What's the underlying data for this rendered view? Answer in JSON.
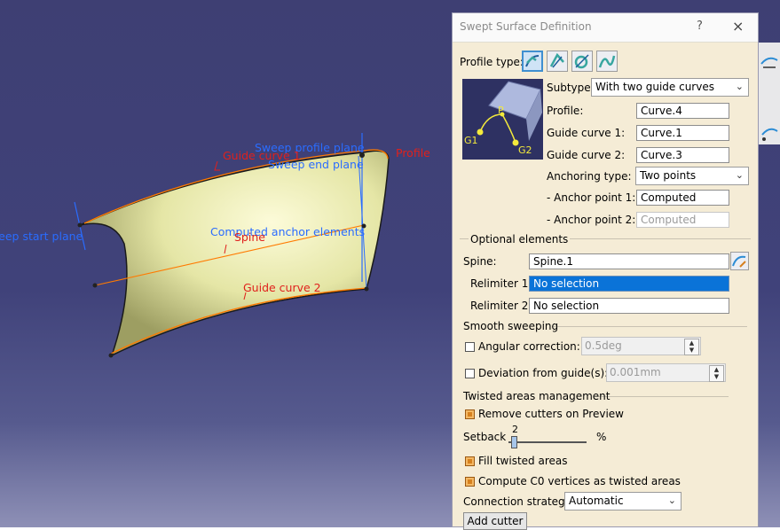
{
  "viewport": {
    "labels": {
      "sweep_profile_plane": "Sweep profile plane",
      "sweep_end_plane": "Sweep end plane",
      "guide_curve_1": "Guide curve 1",
      "profile": "Profile",
      "sweep_start_plane": "Sweep start plane",
      "computed_anchor": "Computed anchor elements",
      "spine": "Spine",
      "guide_curve_2": "Guide curve 2"
    }
  },
  "dialog": {
    "title": "Swept Surface Definition",
    "help": "?",
    "close": "×",
    "profile_type_label": "Profile type:",
    "preview_labels": {
      "p": "P",
      "g1": "G1",
      "g2": "G2"
    },
    "subtype_label": "Subtype:",
    "subtype_value": "With two guide curves",
    "profile_label": "Profile:",
    "profile_value": "Curve.4",
    "guide1_label": "Guide curve 1:",
    "guide1_value": "Curve.1",
    "guide2_label": "Guide curve 2:",
    "guide2_value": "Curve.3",
    "anchoring_label": "Anchoring type:",
    "anchoring_value": "Two points",
    "anchor1_label": "- Anchor point 1:",
    "anchor1_value": "Computed",
    "anchor2_label": "- Anchor point 2:",
    "anchor2_value": "Computed",
    "optional_title": "Optional elements",
    "spine_label": "Spine:",
    "spine_value": "Spine.1",
    "relimiter1_label": "Relimiter 1:",
    "relimiter1_value": "No selection",
    "relimiter2_label": "Relimiter 2:",
    "relimiter2_value": "No selection",
    "smooth_title": "Smooth sweeping",
    "angular_label": "Angular correction:",
    "angular_value": "0.5deg",
    "deviation_label": "Deviation from guide(s):",
    "deviation_value": "0.001mm",
    "twisted_title": "Twisted areas management",
    "remove_cutters_label": "Remove cutters on Preview",
    "setback_label": "Setback",
    "setback_value": "2",
    "setback_unit": "%",
    "fill_twisted_label": "Fill twisted areas",
    "compute_c0_label": "Compute C0 vertices as twisted areas",
    "connection_label": "Connection strategy:",
    "connection_value": "Automatic",
    "add_cutter_label": "Add cutter"
  },
  "colors": {
    "annotation_red": "#e0201c",
    "annotation_blue": "#2a6cff",
    "selection_blue": "#0a73d8",
    "dialog_bg": "#f5ecd6"
  },
  "icons": [
    "help-icon",
    "close-icon",
    "profile-type-explicit-icon",
    "profile-type-line-icon",
    "profile-type-circle-icon",
    "profile-type-conic-icon",
    "spine-select-icon",
    "chevron-down-icon"
  ]
}
